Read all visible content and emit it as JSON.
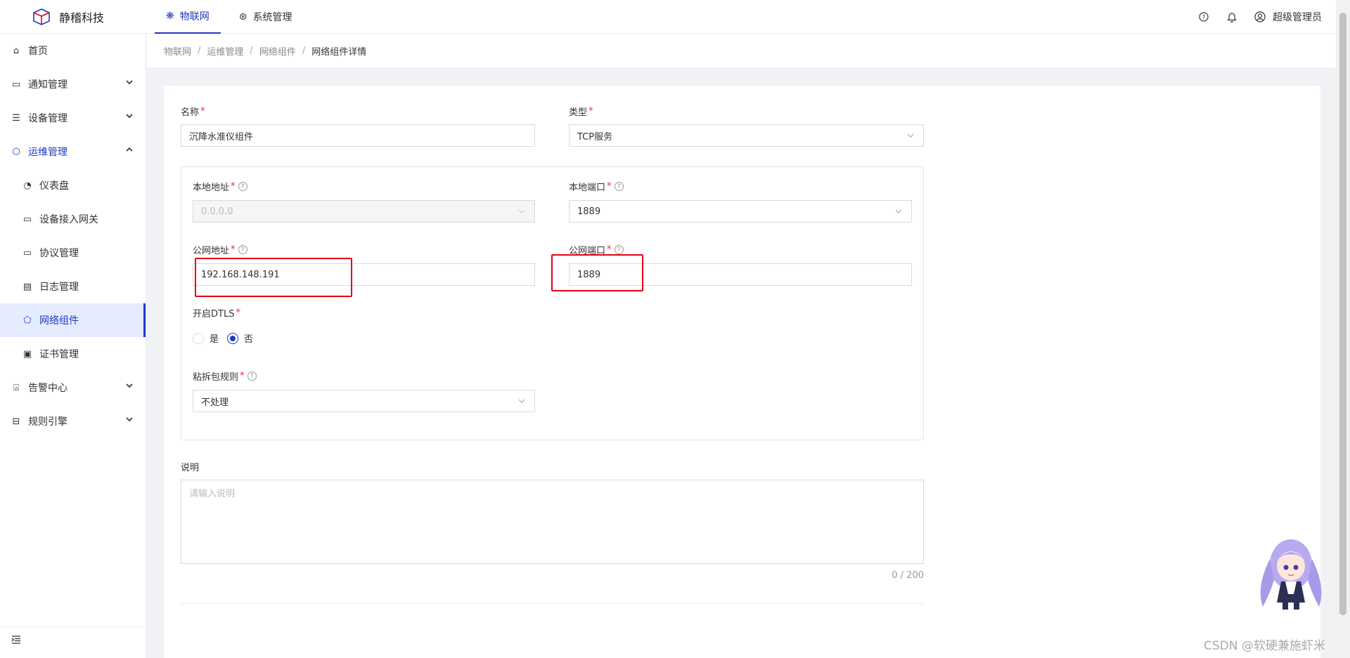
{
  "header": {
    "logo_text": "静稽科技",
    "tabs": [
      {
        "label": "物联网",
        "active": true
      },
      {
        "label": "系统管理",
        "active": false
      }
    ],
    "user_name": "超级管理员"
  },
  "sidebar": {
    "items": [
      {
        "label": "首页"
      },
      {
        "label": "通知管理"
      },
      {
        "label": "设备管理"
      },
      {
        "label": "运维管理"
      },
      {
        "label": "仪表盘"
      },
      {
        "label": "设备接入网关"
      },
      {
        "label": "协议管理"
      },
      {
        "label": "日志管理"
      },
      {
        "label": "网络组件"
      },
      {
        "label": "证书管理"
      },
      {
        "label": "告警中心"
      },
      {
        "label": "规则引擎"
      }
    ]
  },
  "breadcrumb": [
    "物联网",
    "运维管理",
    "网络组件",
    "网络组件详情"
  ],
  "form": {
    "name_label": "名称",
    "name_value": "沉降水准仪组件",
    "type_label": "类型",
    "type_value": "TCP服务",
    "local_addr_label": "本地地址",
    "local_addr_value": "0.0.0.0",
    "local_port_label": "本地端口",
    "local_port_value": "1889",
    "public_addr_label": "公网地址",
    "public_addr_value": "192.168.148.191",
    "public_port_label": "公网端口",
    "public_port_value": "1889",
    "dtls_label": "开启DTLS",
    "dtls_options": [
      "是",
      "否"
    ],
    "dtls_selected": "否",
    "parser_label": "粘拆包规则",
    "parser_value": "不处理",
    "desc_label": "说明",
    "desc_placeholder": "请输入说明",
    "desc_counter": "0 / 200",
    "required_mark": "*",
    "help_mark": "?"
  },
  "watermark": "CSDN @软硬兼施虾米",
  "colors": {
    "primary": "#1d39c4",
    "required": "#f5222d",
    "highlight": "#e60012"
  }
}
